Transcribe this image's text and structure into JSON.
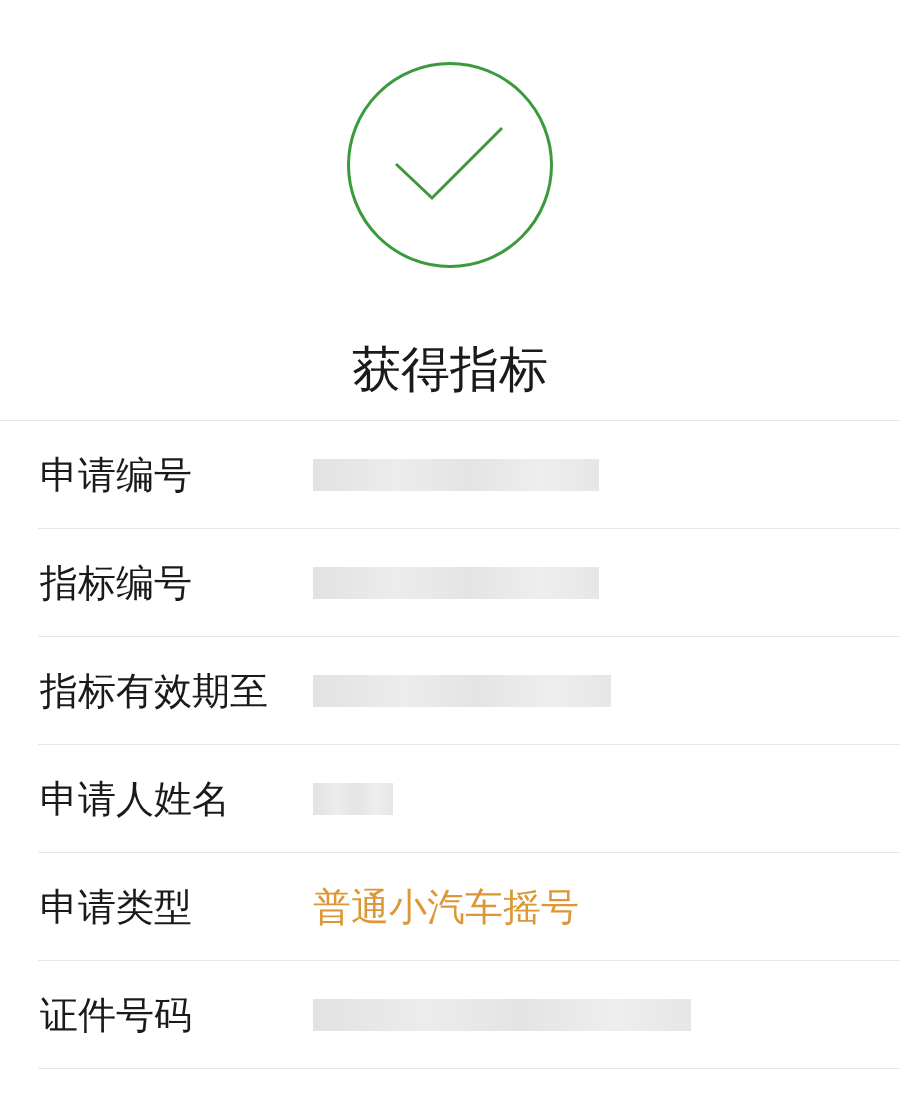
{
  "title": "获得指标",
  "rows": [
    {
      "label": "申请编号",
      "kind": "redacted"
    },
    {
      "label": "指标编号",
      "kind": "redacted"
    },
    {
      "label": "指标有效期至",
      "kind": "redacted"
    },
    {
      "label": "申请人姓名",
      "kind": "redacted"
    },
    {
      "label": "申请类型",
      "kind": "text",
      "value": "普通小汽车摇号"
    },
    {
      "label": "证件号码",
      "kind": "redacted"
    }
  ]
}
